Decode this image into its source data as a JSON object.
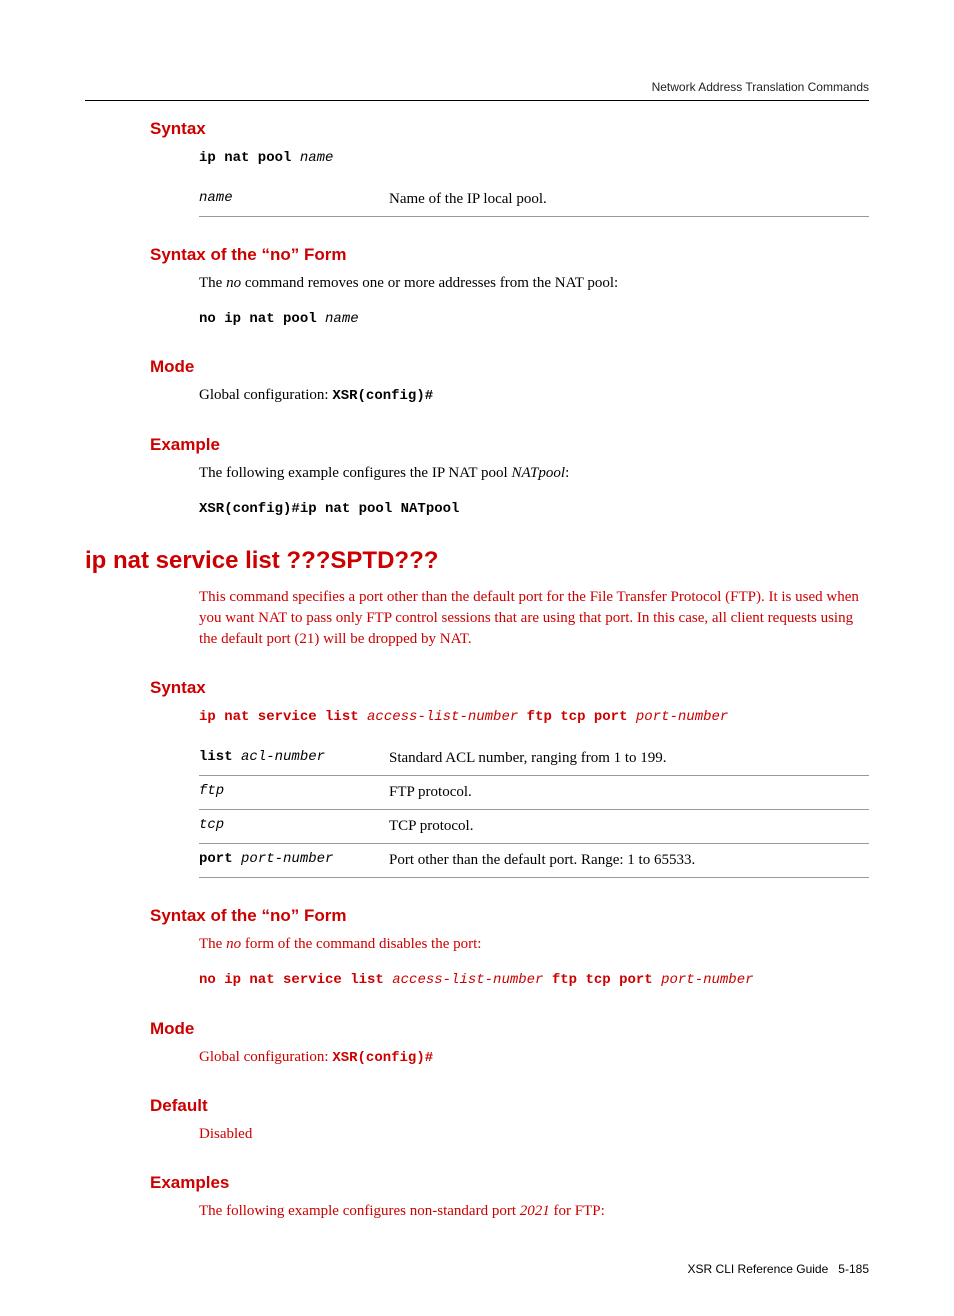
{
  "header": {
    "running_head": "Network Address Translation Commands"
  },
  "sec1": {
    "syntax_h": "Syntax",
    "syntax_cmd_pre": "ip nat pool ",
    "syntax_cmd_arg": "name",
    "param_tbl": [
      {
        "arg": "name",
        "desc": "Name of the IP local pool."
      }
    ],
    "noform_h": "Syntax of the “no” Form",
    "noform_pre": "The ",
    "noform_italic": "no",
    "noform_post": " command removes one or more addresses from the NAT pool:",
    "noform_cmd_pre": "no ip nat pool ",
    "noform_cmd_arg": "name",
    "mode_h": "Mode",
    "mode_pre": "Global configuration: ",
    "mode_mono": "XSR(config)#",
    "example_h": "Example",
    "example_pre": "The following example configures the IP NAT pool ",
    "example_italic": "NATpool",
    "example_post": ":",
    "example_cmd": "XSR(config)#ip nat pool NATpool"
  },
  "sec2": {
    "title": "ip nat service list ???SPTD???",
    "intro": "This command specifies a port other than the default port for the File Transfer Protocol (FTP). It is used when you want NAT to pass only FTP control sessions that are using that port. In this case, all client requests using the default port (21) will be dropped by NAT.",
    "syntax_h": "Syntax",
    "syntax_cmd": {
      "p1": "ip nat service list ",
      "a1": "access-list-number",
      "p2": " ftp tcp port ",
      "a2": "port-number"
    },
    "param_tbl": [
      {
        "arg_b": "list ",
        "arg_i": "acl-number",
        "desc": "Standard ACL number, ranging from 1 to 199."
      },
      {
        "arg_b": "",
        "arg_i": "ftp",
        "desc": "FTP protocol."
      },
      {
        "arg_b": "",
        "arg_i": "tcp",
        "desc": "TCP protocol."
      },
      {
        "arg_b": "port ",
        "arg_i": "port-number",
        "desc": "Port other than the default port. Range: 1 to 65533."
      }
    ],
    "noform_h": "Syntax of the “no” Form",
    "noform_pre": "The ",
    "noform_italic": "no",
    "noform_post": " form of the command disables the port:",
    "noform_cmd": {
      "p1": "no ip nat service list ",
      "a1": "access-list-number",
      "p2": " ftp tcp port ",
      "a2": "port-number"
    },
    "mode_h": "Mode",
    "mode_pre": "Global configuration: ",
    "mode_mono": "XSR(config)#",
    "default_h": "Default",
    "default_val": "Disabled",
    "examples_h": "Examples",
    "examples_pre": "The following example configures non-standard port ",
    "examples_italic": "2021",
    "examples_post": " for FTP:"
  },
  "footer": {
    "left": "XSR CLI Reference Guide",
    "right": "5-185"
  }
}
